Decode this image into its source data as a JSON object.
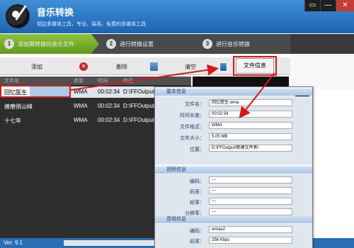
{
  "app": {
    "title": "音乐转换",
    "subtitle": "韧边多媒体工具，专业、易用，免费的多媒体工具",
    "window_controls": [
      "▭",
      "—",
      "✕"
    ]
  },
  "steps": [
    {
      "num": "1",
      "label": "添加需转换的音乐文件"
    },
    {
      "num": "2",
      "label": "进行转换设置"
    },
    {
      "num": "3",
      "label": "进行音乐转换"
    }
  ],
  "toolbar": {
    "add_label": "添加",
    "delete_label": "删除",
    "clear_label": "清空",
    "file_info_label": "文件信息"
  },
  "file_list": {
    "columns": [
      "文件名",
      "类型",
      "时间",
      "路径"
    ],
    "rows": [
      {
        "name": "回忆医生",
        "type": "WMA",
        "time": "00:02:34",
        "path": "D:\\FFOutput\\"
      },
      {
        "name": "缠磨俏山峰",
        "type": "WMA",
        "time": "00:02:34",
        "path": "D:\\FFOutput\\"
      },
      {
        "name": "十七年",
        "type": "WMA",
        "time": "00:02:34",
        "path": "D:\\FFOutput\\"
      }
    ]
  },
  "status": {
    "version": "Ver. 9.1"
  },
  "dialog": {
    "close": "✕",
    "basic": {
      "title": "基本信息",
      "fields": [
        {
          "label": "文件名：",
          "value": "回忆医生.wma"
        },
        {
          "label": "时间长度：",
          "value": "00:02:34"
        },
        {
          "label": "文件格式：",
          "value": "WMA"
        },
        {
          "label": "文件大小：",
          "value": "5.05 MB"
        },
        {
          "label": "位置：",
          "value": "D:\\FFOutput\\新建文件夹\\"
        }
      ]
    },
    "video": {
      "title": "视频信息",
      "fields": [
        {
          "label": "编码：",
          "value": "---"
        },
        {
          "label": "码率：",
          "value": "---"
        },
        {
          "label": "帧率：",
          "value": "---"
        },
        {
          "label": "分辨率：",
          "value": "---"
        }
      ]
    },
    "audio": {
      "title": "音频信息",
      "fields": [
        {
          "label": "编码：",
          "value": "wmav2"
        },
        {
          "label": "码率：",
          "value": "256 Kbps"
        }
      ]
    }
  },
  "colors": {
    "highlight": "#d81818",
    "title_bar": "#2a74c6",
    "step_active": "#7ab32c"
  }
}
